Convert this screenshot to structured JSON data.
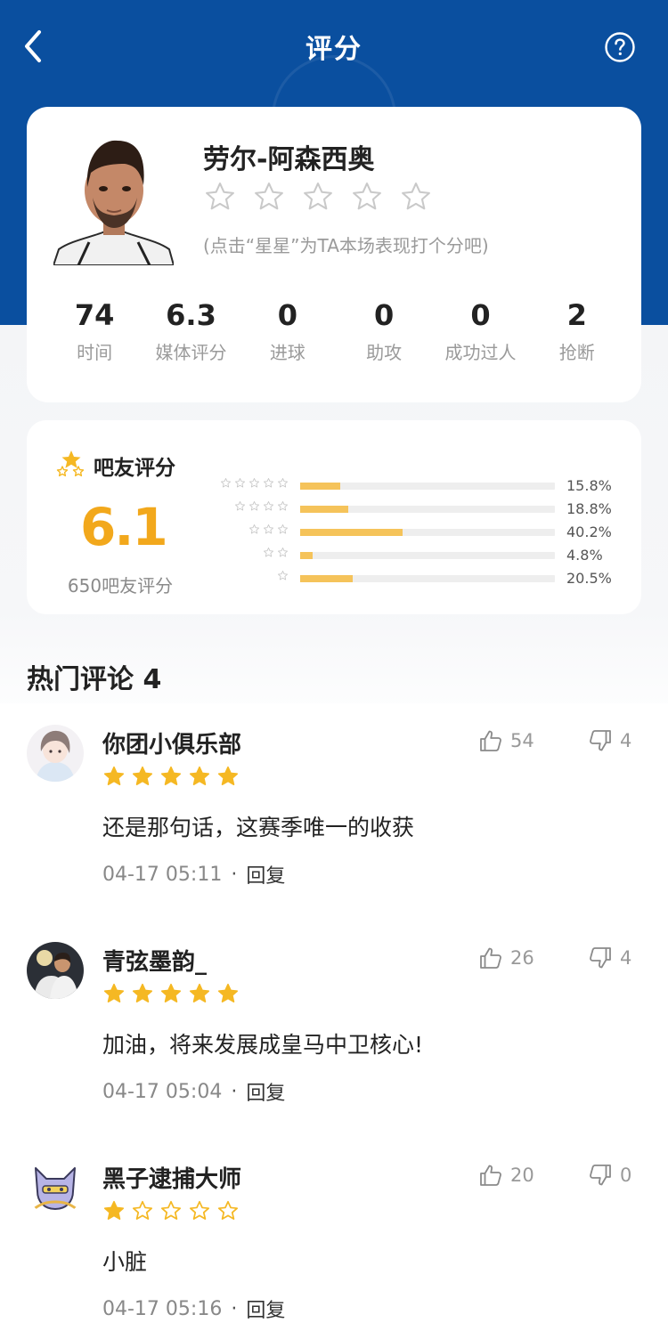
{
  "header": {
    "title": "评分",
    "back_icon": "chevron-left-icon",
    "help_icon": "question-circle-icon",
    "bg_color": "#0a4f9f"
  },
  "player": {
    "name": "劳尔-阿森西奥",
    "rating_stars": 5,
    "rating_hint": "(点击“星星”为TA本场表现打个分吧)",
    "stats": [
      {
        "value": "74",
        "label": "时间"
      },
      {
        "value": "6.3",
        "label": "媒体评分"
      },
      {
        "value": "0",
        "label": "进球"
      },
      {
        "value": "0",
        "label": "助攻"
      },
      {
        "value": "0",
        "label": "成功过人"
      },
      {
        "value": "2",
        "label": "抢断"
      }
    ]
  },
  "fan_rating": {
    "title": "吧友评分",
    "score": "6.1",
    "count_label": "650吧友评分",
    "accent_color": "#f2a81c",
    "bar_color": "#f5c35a",
    "distribution": [
      {
        "stars": 5,
        "percent": 15.8,
        "label": "15.8%"
      },
      {
        "stars": 4,
        "percent": 18.8,
        "label": "18.8%"
      },
      {
        "stars": 3,
        "percent": 40.2,
        "label": "40.2%"
      },
      {
        "stars": 2,
        "percent": 4.8,
        "label": "4.8%"
      },
      {
        "stars": 1,
        "percent": 20.5,
        "label": "20.5%"
      }
    ]
  },
  "comments_section": {
    "title": "热门评论 4",
    "comments": [
      {
        "user": "你团小俱乐部",
        "stars": 5,
        "text": "还是那句话，这赛季唯一的收获",
        "time": "04-17 05:11",
        "reply_label": "回复",
        "likes": "54",
        "dislikes": "4"
      },
      {
        "user": "青弦墨韵_",
        "stars": 5,
        "text": "加油，将来发展成皇马中卫核心!",
        "time": "04-17 05:04",
        "reply_label": "回复",
        "likes": "26",
        "dislikes": "4"
      },
      {
        "user": "黑子逮捕大师",
        "stars": 1,
        "text": "小脏",
        "time": "04-17 05:16",
        "reply_label": "回复",
        "likes": "20",
        "dislikes": "0"
      }
    ]
  }
}
